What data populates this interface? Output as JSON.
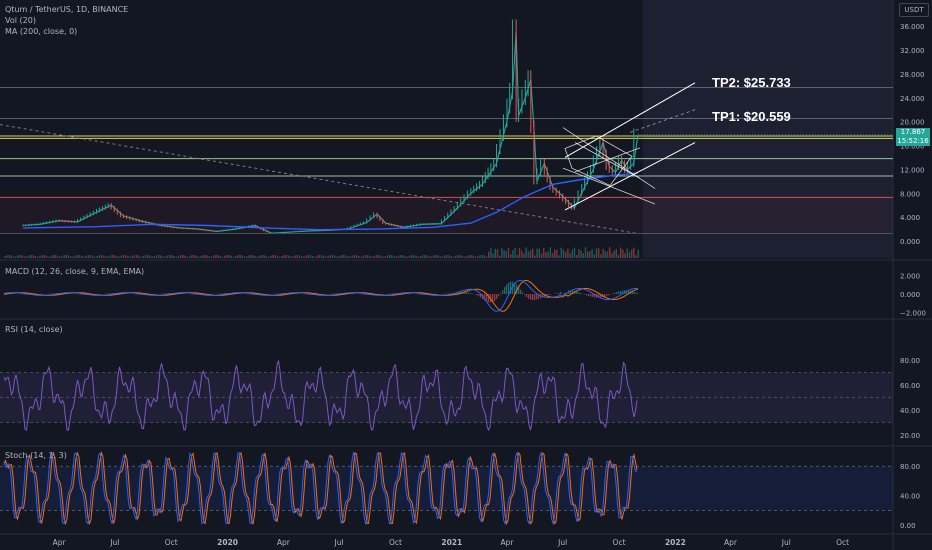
{
  "header": {
    "symbol_line": "Qtum / TetherUS, 1D, BINANCE",
    "vol_label": "Vol (20)",
    "ma_label": "MA (200, close, 0)",
    "currency": "USDT"
  },
  "current_price": {
    "price": "17.867",
    "countdown": "15:52:16"
  },
  "annotations": {
    "tp2": "TP2: $25.733",
    "tp1": "TP1: $20.559"
  },
  "indicators": {
    "macd_label": "MACD (12, 26, close, 9, EMA, EMA)",
    "rsi_label": "RSI (14, close)",
    "stoch_label": "Stoch (14, 1, 3)"
  },
  "colors": {
    "background": "#131722",
    "price_line": "#26a69a",
    "ma_line": "#2962ff",
    "macd_line": "#2962ff",
    "signal_line": "#ff6d00",
    "rsi_line": "#7e57c2",
    "stoch_k": "#2962ff",
    "stoch_d": "#ff6d00",
    "up_candle": "#26a69a",
    "down_candle": "#ef5350",
    "hline_yellow": "#f5e663",
    "hline_green": "#a5d6a7",
    "hline_red": "#ef5350",
    "hline_gray": "#b2b5be",
    "channel": "#ffffff"
  },
  "chart_data": [
    {
      "type": "line",
      "title": "Qtum / TetherUS, 1D, BINANCE",
      "x_ticks": [
        "Apr",
        "Jul",
        "Oct",
        "2020",
        "Apr",
        "Jul",
        "Oct",
        "2021",
        "Apr",
        "Jul",
        "Oct",
        "2022",
        "Apr",
        "Jul",
        "Oct"
      ],
      "y_ticks": [
        0,
        4,
        8,
        12,
        16,
        20,
        24,
        28,
        32,
        36
      ],
      "y_tick_labels": [
        "0.000",
        "4.000",
        "8.000",
        "12.000",
        "16.000",
        "20.000",
        "24.000",
        "28.000",
        "32.000",
        "36.000"
      ],
      "ylim": [
        0,
        37.5
      ],
      "x_date_range": [
        "2019-02-01",
        "2022-12-31"
      ],
      "series": [
        {
          "values_kind": "price",
          "points": [
            [
              "2019-02-01",
              2.6
            ],
            [
              "2019-03-01",
              2.8
            ],
            [
              "2019-04-01",
              3.4
            ],
            [
              "2019-05-01",
              3.2
            ],
            [
              "2019-06-01",
              4.8
            ],
            [
              "2019-06-25",
              6.0
            ],
            [
              "2019-07-15",
              4.2
            ],
            [
              "2019-08-15",
              3.3
            ],
            [
              "2019-09-15",
              2.6
            ],
            [
              "2019-10-15",
              2.2
            ],
            [
              "2019-11-15",
              2.0
            ],
            [
              "2019-12-15",
              1.6
            ],
            [
              "2020-01-15",
              2.0
            ],
            [
              "2020-02-15",
              2.6
            ],
            [
              "2020-03-13",
              1.3
            ],
            [
              "2020-04-15",
              1.5
            ],
            [
              "2020-05-15",
              1.7
            ],
            [
              "2020-06-15",
              1.8
            ],
            [
              "2020-07-15",
              2.0
            ],
            [
              "2020-08-15",
              3.1
            ],
            [
              "2020-09-01",
              4.5
            ],
            [
              "2020-09-15",
              3.0
            ],
            [
              "2020-10-15",
              2.3
            ],
            [
              "2020-11-15",
              2.8
            ],
            [
              "2020-12-15",
              2.9
            ],
            [
              "2021-01-10",
              5.5
            ],
            [
              "2021-02-01",
              8.0
            ],
            [
              "2021-02-20",
              9.5
            ],
            [
              "2021-03-15",
              13.0
            ],
            [
              "2021-04-01",
              20.0
            ],
            [
              "2021-04-10",
              25.0
            ],
            [
              "2021-04-16",
              35.0
            ],
            [
              "2021-04-20",
              21.0
            ],
            [
              "2021-05-01",
              24.0
            ],
            [
              "2021-05-10",
              27.0
            ],
            [
              "2021-05-15",
              19.0
            ],
            [
              "2021-05-20",
              10.0
            ],
            [
              "2021-06-01",
              13.0
            ],
            [
              "2021-06-15",
              9.0
            ],
            [
              "2021-07-01",
              7.5
            ],
            [
              "2021-07-20",
              5.5
            ],
            [
              "2021-08-01",
              8.0
            ],
            [
              "2021-08-20",
              12.0
            ],
            [
              "2021-09-05",
              16.5
            ],
            [
              "2021-09-15",
              12.5
            ],
            [
              "2021-09-25",
              11.5
            ],
            [
              "2021-10-05",
              13.5
            ],
            [
              "2021-10-15",
              12.0
            ],
            [
              "2021-10-25",
              13.0
            ],
            [
              "2021-11-01",
              17.8
            ]
          ]
        },
        {
          "name": "MA (200, close, 0)",
          "points": [
            [
              "2019-02-01",
              2.2
            ],
            [
              "2019-06-01",
              2.4
            ],
            [
              "2019-09-01",
              2.8
            ],
            [
              "2019-12-01",
              2.6
            ],
            [
              "2020-03-01",
              2.2
            ],
            [
              "2020-06-01",
              1.9
            ],
            [
              "2020-09-01",
              2.0
            ],
            [
              "2020-12-01",
              2.3
            ],
            [
              "2021-02-01",
              3.0
            ],
            [
              "2021-03-15",
              4.8
            ],
            [
              "2021-05-01",
              7.5
            ],
            [
              "2021-06-15",
              9.5
            ],
            [
              "2021-08-01",
              10.3
            ],
            [
              "2021-09-15",
              10.9
            ],
            [
              "2021-11-01",
              11.4
            ]
          ]
        }
      ],
      "horizontal_levels": [
        {
          "value": 25.733,
          "color": "gray"
        },
        {
          "value": 20.559,
          "color": "gray"
        },
        {
          "value": 17.6,
          "color": "yellow"
        },
        {
          "value": 17.2,
          "color": "yellow"
        },
        {
          "value": 13.8,
          "color": "green"
        },
        {
          "value": 10.9,
          "color": "green"
        },
        {
          "value": 7.3,
          "color": "red"
        },
        {
          "value": 1.3,
          "color": "gray"
        }
      ]
    },
    {
      "type": "bar",
      "title": "Vol (20)"
    },
    {
      "type": "line",
      "title": "MACD (12, 26, close, 9, EMA, EMA)",
      "y_ticks": [
        -2,
        0,
        2
      ],
      "y_tick_labels": [
        "−2.000",
        "0.000",
        "2.000"
      ],
      "ylim": [
        -3,
        3
      ]
    },
    {
      "type": "line",
      "title": "RSI (14, close)",
      "y_ticks": [
        20,
        40,
        60,
        80
      ],
      "y_tick_labels": [
        "20.00",
        "40.00",
        "60.00",
        "80.00"
      ],
      "bands": [
        30,
        70
      ],
      "ylim": [
        14,
        90
      ]
    },
    {
      "type": "line",
      "title": "Stoch (14, 1, 3)",
      "y_ticks": [
        0,
        40,
        80
      ],
      "y_tick_labels": [
        "0.00",
        "40.00",
        "80.00"
      ],
      "bands": [
        20,
        80
      ],
      "ylim": [
        -5,
        105
      ]
    }
  ]
}
